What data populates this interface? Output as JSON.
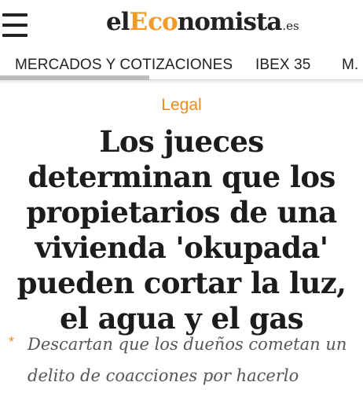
{
  "header": {
    "menu_icon": "hamburger-menu-icon",
    "logo": {
      "el": "el",
      "E": "E",
      "co": "co",
      "rest": "nomista",
      "tld": ".es"
    }
  },
  "nav": {
    "items": [
      "MERCADOS Y COTIZACIONES",
      "IBEX 35",
      "M."
    ]
  },
  "article": {
    "category": "Legal",
    "headline": "Los jueces determinan que los propietarios de una vivienda 'okupada' pueden cortar la luz, el agua y el gas",
    "summary_bullet": "*",
    "summary": "Descartan que los dueños cometan un delito de coacciones por hacerlo"
  },
  "colors": {
    "accent": "#f08a1a",
    "text": "#1c1c1c",
    "summary_text": "#555555"
  }
}
